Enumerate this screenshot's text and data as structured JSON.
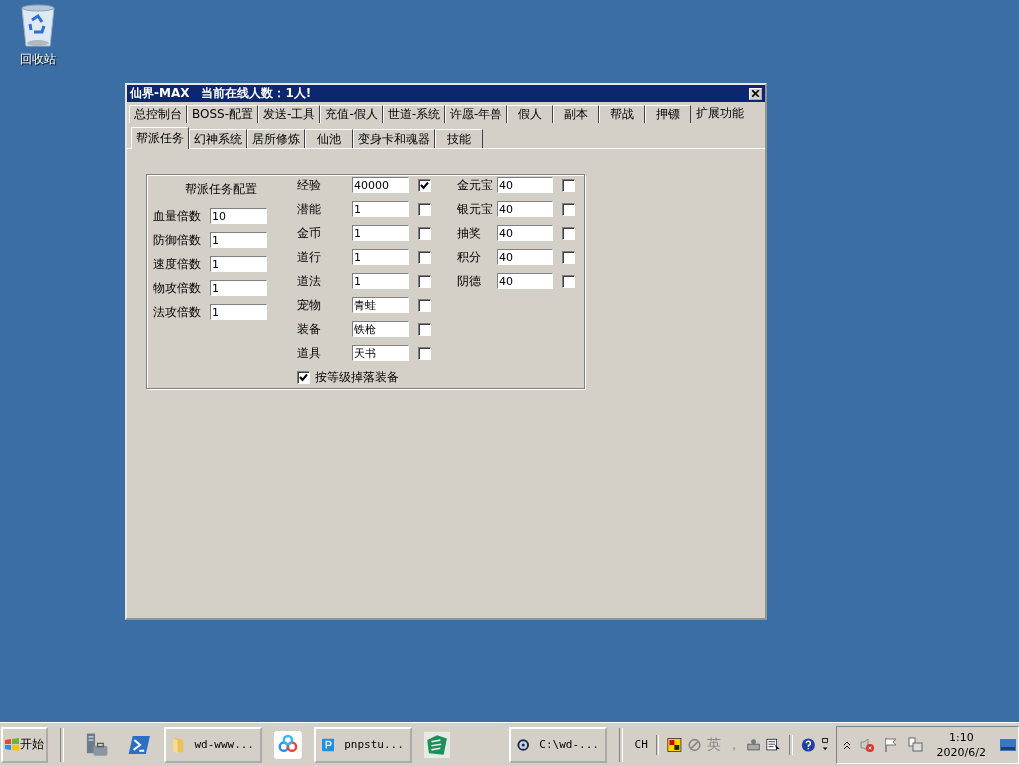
{
  "desktop_icons": [
    {
      "label": "回收站"
    }
  ],
  "window": {
    "title": "仙界-MAX　当前在线人数：1人!"
  },
  "tabs": [
    {
      "label": "总控制台",
      "selected": false
    },
    {
      "label": "BOSS-配置",
      "selected": false
    },
    {
      "label": "发送-工具",
      "selected": false
    },
    {
      "label": "充值-假人",
      "selected": false
    },
    {
      "label": "世道-系统",
      "selected": false
    },
    {
      "label": "许愿-年兽",
      "selected": false
    },
    {
      "label": "假人",
      "selected": false
    },
    {
      "label": "副本",
      "selected": false
    },
    {
      "label": "帮战",
      "selected": false
    },
    {
      "label": "押镖",
      "selected": false
    },
    {
      "label": "扩展功能",
      "selected": true
    }
  ],
  "subtabs": [
    {
      "label": "帮派任务",
      "selected": true
    },
    {
      "label": "幻神系统",
      "selected": false
    },
    {
      "label": "居所修炼",
      "selected": false
    },
    {
      "label": "仙池",
      "selected": false
    },
    {
      "label": "变身卡和魂器",
      "selected": false
    },
    {
      "label": "技能",
      "selected": false
    }
  ],
  "group": {
    "title": "帮派任务配置",
    "multipliers": [
      {
        "label": "血量倍数",
        "value": "10"
      },
      {
        "label": "防御倍数",
        "value": "1"
      },
      {
        "label": "速度倍数",
        "value": "1"
      },
      {
        "label": "物攻倍数",
        "value": "1"
      },
      {
        "label": "法攻倍数",
        "value": "1"
      }
    ],
    "rewards": [
      {
        "label": "经验",
        "value": "40000",
        "checked": true
      },
      {
        "label": "潜能",
        "value": "1",
        "checked": false
      },
      {
        "label": "金币",
        "value": "1",
        "checked": false
      },
      {
        "label": "道行",
        "value": "1",
        "checked": false
      },
      {
        "label": "道法",
        "value": "1",
        "checked": false
      },
      {
        "label": "宠物",
        "value": "青蛙",
        "checked": false
      },
      {
        "label": "装备",
        "value": "铁枪",
        "checked": false
      },
      {
        "label": "道具",
        "value": "天书",
        "checked": false
      }
    ],
    "currencies": [
      {
        "label": "金元宝",
        "value": "40",
        "checked": false
      },
      {
        "label": "银元宝",
        "value": "40",
        "checked": false
      },
      {
        "label": "抽奖",
        "value": "40",
        "checked": false
      },
      {
        "label": "积分",
        "value": "40",
        "checked": false
      },
      {
        "label": "阴德",
        "value": "40",
        "checked": false
      }
    ],
    "drop_by_level": {
      "label": "按等级掉落装备",
      "checked": true
    }
  },
  "taskbar": {
    "start": "开始",
    "buttons": [
      {
        "label": "wd-www..."
      },
      {
        "label": "pnpstu..."
      },
      {
        "label": "C:\\wd-..."
      }
    ],
    "language": "CH",
    "ime": [
      "英",
      "，"
    ],
    "time": "1:10",
    "date": "2020/6/2"
  }
}
